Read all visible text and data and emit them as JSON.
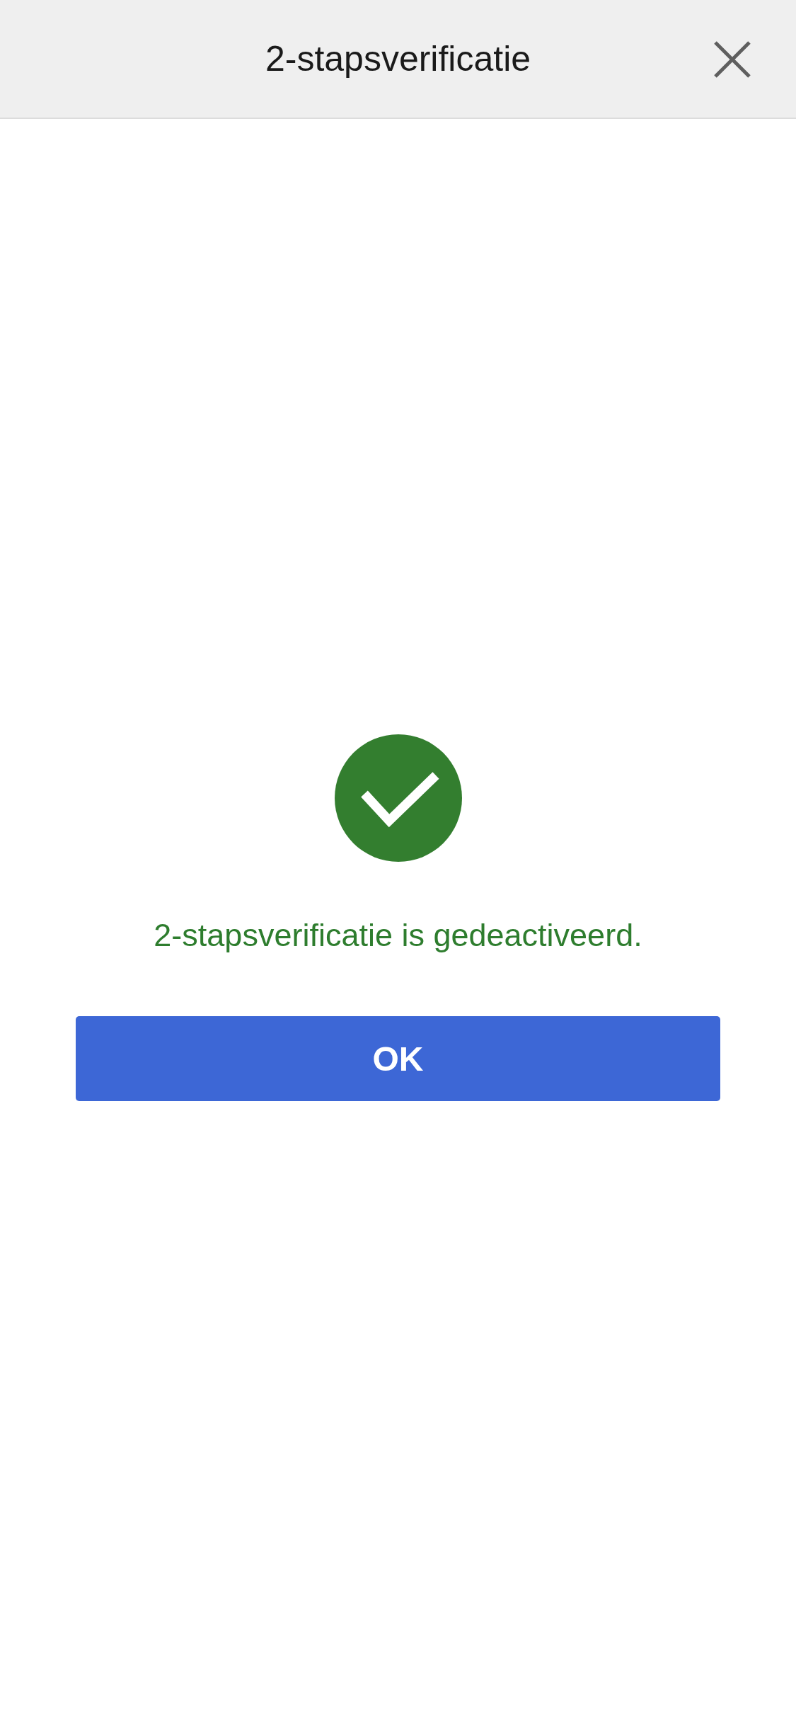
{
  "header": {
    "title": "2-stapsverificatie"
  },
  "message": "2-stapsverificatie is gedeactiveerd.",
  "buttons": [
    "OK"
  ]
}
